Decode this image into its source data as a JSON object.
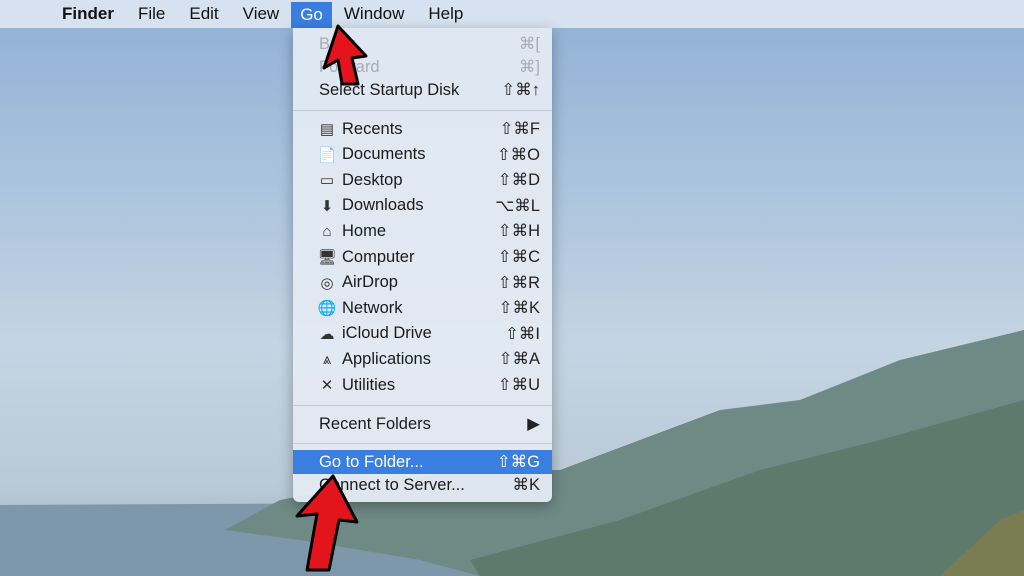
{
  "menubar": {
    "apple_icon": "apple-logo",
    "app": "Finder",
    "items": [
      "File",
      "Edit",
      "View",
      "Go",
      "Window",
      "Help"
    ],
    "active": "Go"
  },
  "go_menu": {
    "top": [
      {
        "label": "Back",
        "shortcut": "⌘[",
        "disabled": true
      },
      {
        "label": "Forward",
        "shortcut": "⌘]",
        "disabled": true
      },
      {
        "label": "Select Startup Disk",
        "shortcut": "⇧⌘↑"
      }
    ],
    "places": [
      {
        "label": "Recents",
        "shortcut": "⇧⌘F",
        "icon": "recents-icon",
        "glyph": "▤"
      },
      {
        "label": "Documents",
        "shortcut": "⇧⌘O",
        "icon": "documents-icon",
        "glyph": "📄"
      },
      {
        "label": "Desktop",
        "shortcut": "⇧⌘D",
        "icon": "desktop-icon",
        "glyph": "▭"
      },
      {
        "label": "Downloads",
        "shortcut": "⌥⌘L",
        "icon": "downloads-icon",
        "glyph": "⬇"
      },
      {
        "label": "Home",
        "shortcut": "⇧⌘H",
        "icon": "home-icon",
        "glyph": "⌂"
      },
      {
        "label": "Computer",
        "shortcut": "⇧⌘C",
        "icon": "computer-icon",
        "glyph": "🖥"
      },
      {
        "label": "AirDrop",
        "shortcut": "⇧⌘R",
        "icon": "airdrop-icon",
        "glyph": "◎"
      },
      {
        "label": "Network",
        "shortcut": "⇧⌘K",
        "icon": "network-icon",
        "glyph": "🌐"
      },
      {
        "label": "iCloud Drive",
        "shortcut": "⇧⌘I",
        "icon": "icloud-icon",
        "glyph": "☁"
      },
      {
        "label": "Applications",
        "shortcut": "⇧⌘A",
        "icon": "applications-icon",
        "glyph": "⩓"
      },
      {
        "label": "Utilities",
        "shortcut": "⇧⌘U",
        "icon": "utilities-icon",
        "glyph": "✕"
      }
    ],
    "recent_folders": {
      "label": "Recent Folders",
      "submenu": "▶"
    },
    "bottom": [
      {
        "label": "Go to Folder...",
        "shortcut": "⇧⌘G",
        "highlighted": true
      },
      {
        "label": "Connect to Server...",
        "shortcut": "⌘K"
      }
    ]
  },
  "colors": {
    "highlight": "#3a7ee0",
    "arrow": "#e3141b"
  }
}
